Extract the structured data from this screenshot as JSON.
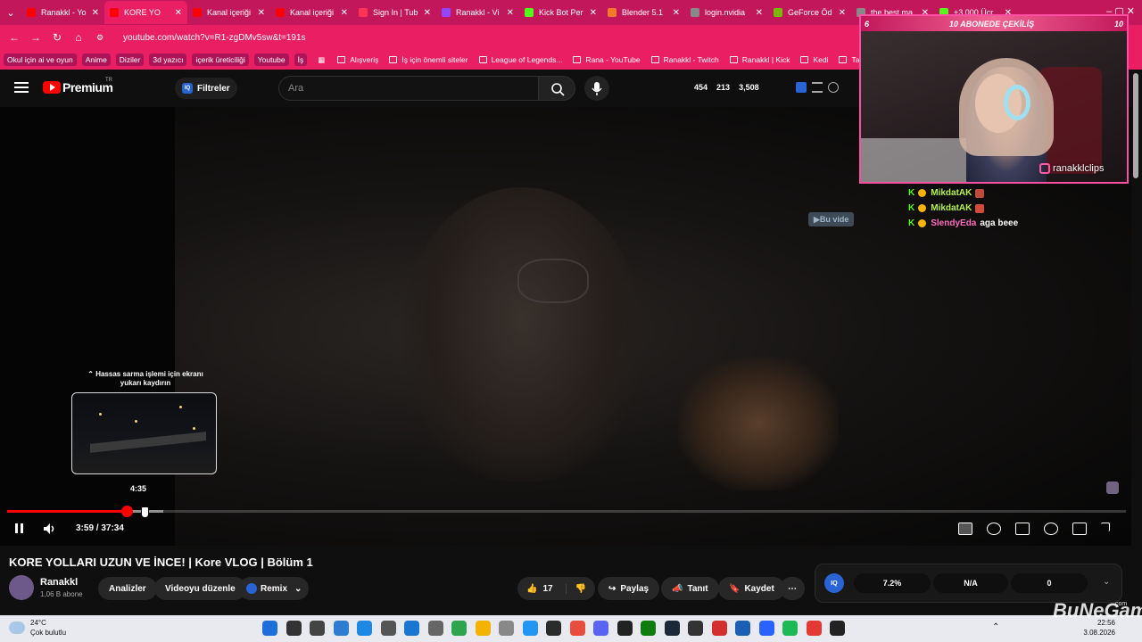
{
  "browser": {
    "tabs": [
      {
        "title": "Ranakkl - Yo",
        "color": "#ff0000"
      },
      {
        "title": "KORE YO",
        "color": "#ff0000",
        "active": true
      },
      {
        "title": "Kanal içeriği",
        "color": "#ff0000"
      },
      {
        "title": "Kanal içeriği",
        "color": "#ff0000"
      },
      {
        "title": "Sign In | Tub",
        "color": "#ff3355"
      },
      {
        "title": "Ranakkl - Vi",
        "color": "#9146ff"
      },
      {
        "title": "Kick Bot Per",
        "color": "#53fc18"
      },
      {
        "title": "Blender 5.1",
        "color": "#f5792a"
      },
      {
        "title": "login.nvidia",
        "color": "#888888"
      },
      {
        "title": "GeForce Öd",
        "color": "#76b900"
      },
      {
        "title": "the best ma",
        "color": "#888888"
      },
      {
        "title": "+3.000 Ücr",
        "color": "#53fc18"
      }
    ],
    "url": "youtube.com/watch?v=R1-zgDMv5sw&t=191s",
    "bookmark_chips": [
      "Okul için ai ve oyun",
      "Anime",
      "Diziler",
      "3d yazıcı",
      "içerik üreticiliği",
      "Youtube",
      "İş"
    ],
    "bookmarks": [
      "Alışveriş",
      "İş için önemli siteler",
      "League of Legends...",
      "Rana - YouTube",
      "Ranakkl - Twitch",
      "Ranakkl | Kick",
      "Kedi",
      "Tarifler"
    ]
  },
  "yt_header": {
    "brand": "Premium",
    "brand_sup": "TR",
    "filter_label": "Filtreler",
    "filter_icon": "IQ",
    "search_placeholder": "Ara",
    "stats": [
      "454",
      "213",
      "3,508"
    ]
  },
  "player": {
    "scrub_hint": "Hassas sarma işlemi için ekranı yukarı kaydırın",
    "preview_time": "4:35",
    "current_time": "3:59",
    "duration": "37:34",
    "time_display": "3:59 / 37:34",
    "progress_fraction": 0.106,
    "info_button": "Bu vide"
  },
  "overlay": {
    "banner_left": "6",
    "banner_text": "10 ABONEDE ÇEKİLİŞ",
    "banner_right": "10",
    "instagram": "ranakklclips"
  },
  "chat": [
    {
      "name": "MikdatAK",
      "color": "#b6f04e",
      "message": ""
    },
    {
      "name": "MikdatAK",
      "color": "#b6f04e",
      "message": ""
    },
    {
      "name": "SlendyEda",
      "color": "#ff6fbf",
      "message": "aga beee"
    }
  ],
  "video": {
    "title": "KORE YOLLARI UZUN VE İNCE! | Kore VLOG | Bölüm 1",
    "channel": "Ranakkl",
    "subscribers": "1,06 B abone",
    "buttons": {
      "analytics": "Analizler",
      "edit": "Videoyu düzenle",
      "remix": "Remix",
      "likes": "17",
      "share": "Paylaş",
      "promote": "Tanıt",
      "save": "Kaydet"
    },
    "iq_stats": [
      "7.2%",
      "N/A",
      "0"
    ]
  },
  "taskbar": {
    "temp": "24°C",
    "weather": "Çok bulutlu",
    "time": "22:56",
    "date": "3.08.2026"
  },
  "watermark": {
    "main": "BuNeGame",
    "sub": ".com"
  }
}
